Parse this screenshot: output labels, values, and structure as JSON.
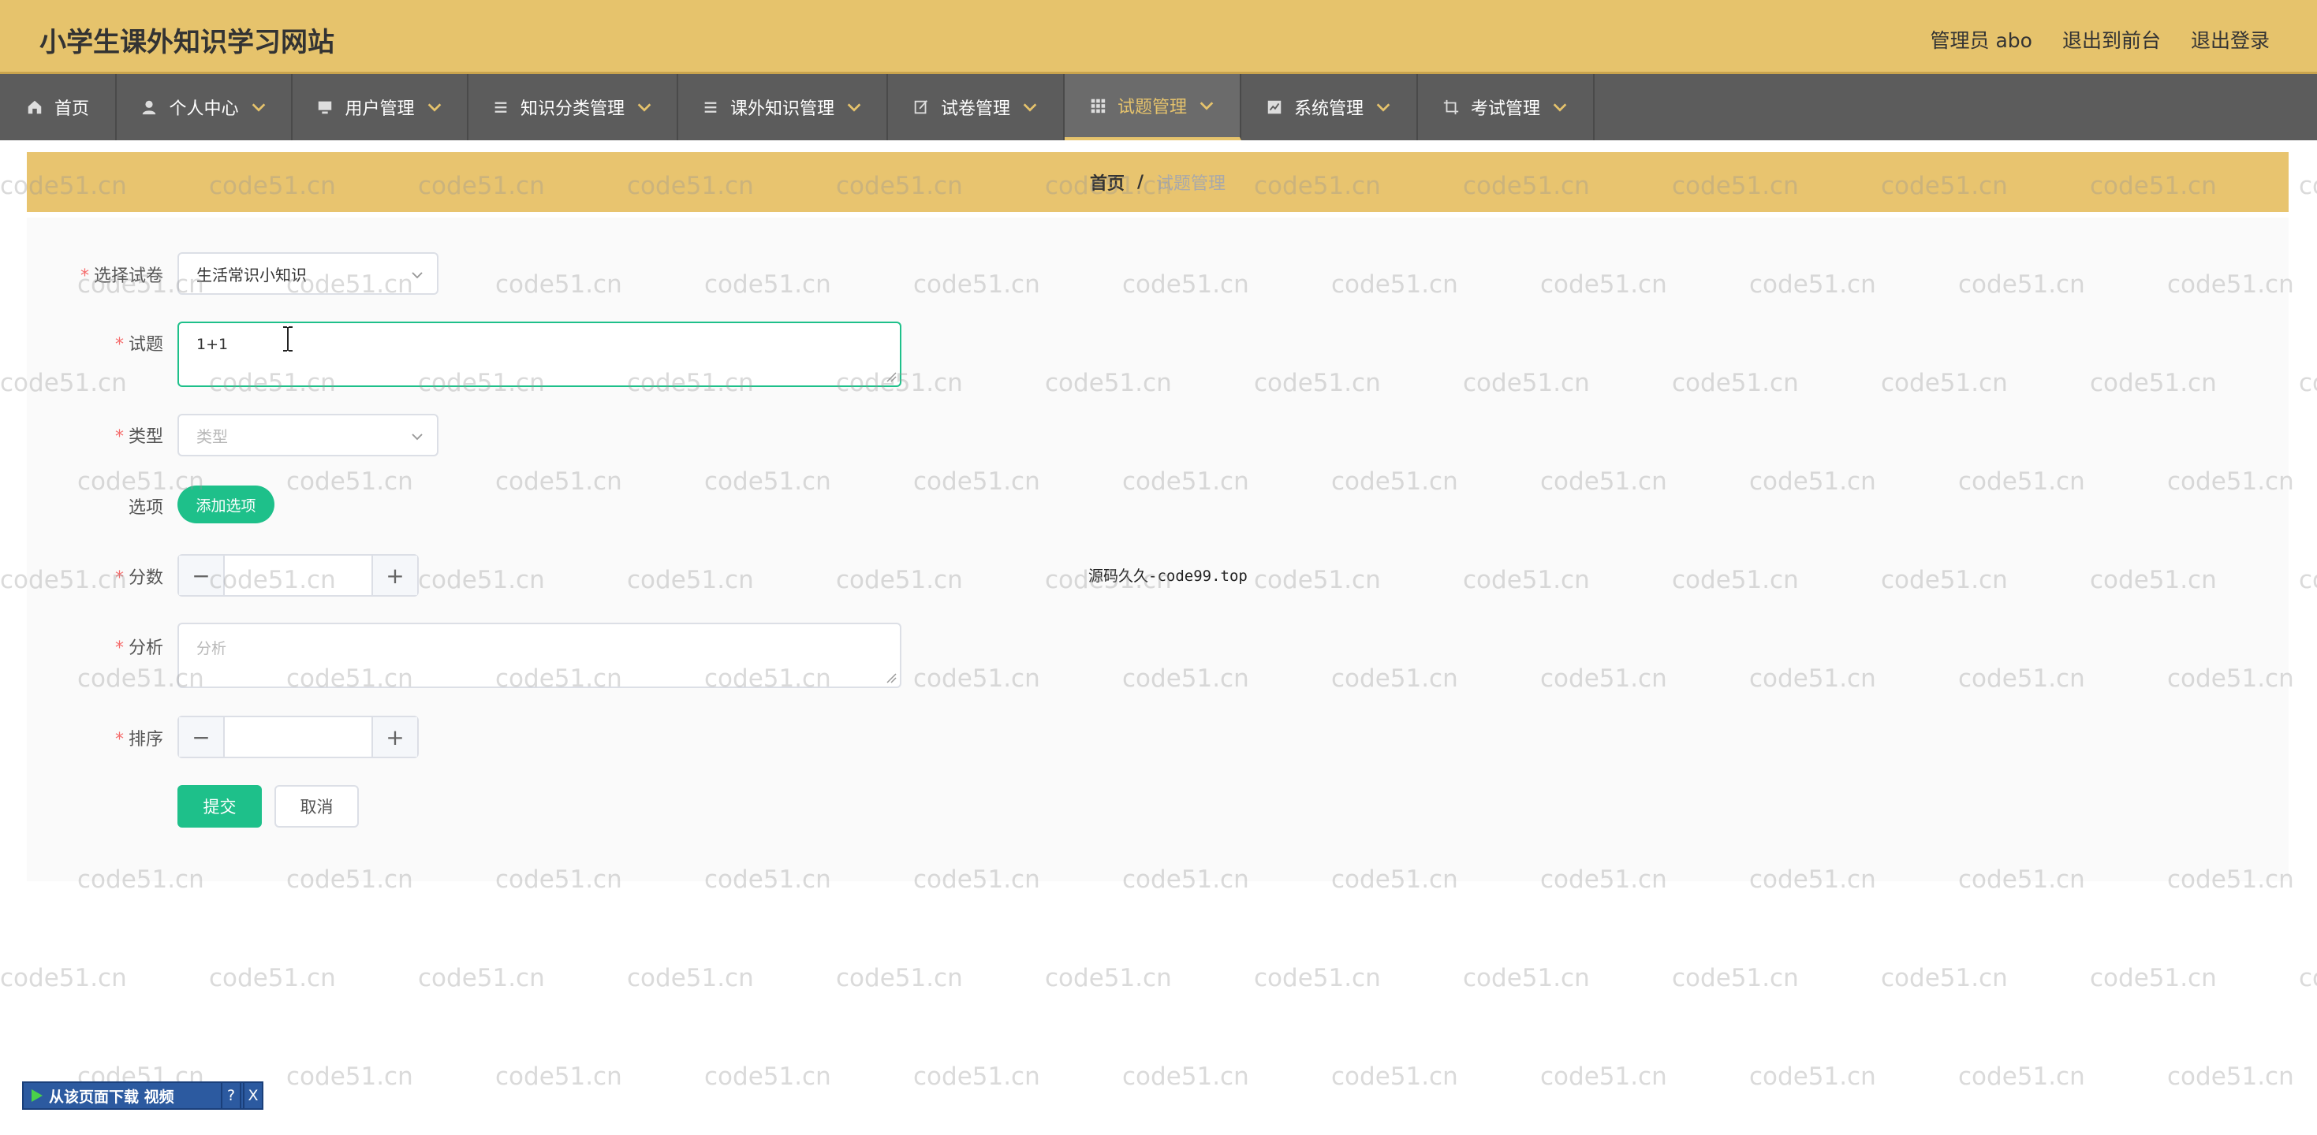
{
  "header": {
    "site_title": "小学生课外知识学习网站",
    "admin_label": "管理员 abo",
    "to_frontend": "退出到前台",
    "logout": "退出登录"
  },
  "menu": {
    "items": [
      {
        "label": "首页",
        "icon": "home-icon"
      },
      {
        "label": "个人中心",
        "icon": "user-icon"
      },
      {
        "label": "用户管理",
        "icon": "monitor-icon"
      },
      {
        "label": "知识分类管理",
        "icon": "list-icon"
      },
      {
        "label": "课外知识管理",
        "icon": "list-icon"
      },
      {
        "label": "试卷管理",
        "icon": "edit-icon"
      },
      {
        "label": "试题管理",
        "icon": "grid-icon"
      },
      {
        "label": "系统管理",
        "icon": "chart-icon"
      },
      {
        "label": "考试管理",
        "icon": "crop-icon"
      }
    ]
  },
  "breadcrumb": {
    "home": "首页",
    "separator": "/",
    "current": "试题管理"
  },
  "form": {
    "paper": {
      "label": "选择试卷",
      "value": "生活常识小知识"
    },
    "question": {
      "label": "试题",
      "value": "1+1"
    },
    "type": {
      "label": "类型",
      "placeholder": "类型"
    },
    "options": {
      "label": "选项",
      "add_button": "添加选项"
    },
    "score": {
      "label": "分数",
      "minus": "−",
      "plus": "+"
    },
    "analysis": {
      "label": "分析",
      "placeholder": "分析"
    },
    "order": {
      "label": "排序",
      "minus": "−",
      "plus": "+"
    },
    "submit": "提交",
    "cancel": "取消",
    "required_mark": "*"
  },
  "overlay_note": "源码久久-code99.top",
  "watermark_text": "code51.cn",
  "download_bar": {
    "label": "从该页面下载 视频",
    "help": "?",
    "close": "X"
  },
  "colors": {
    "header_bg": "#e6c36c",
    "menu_bg": "#5c5c5c",
    "accent_green": "#1ec08a",
    "required_red": "#f56c6c"
  }
}
